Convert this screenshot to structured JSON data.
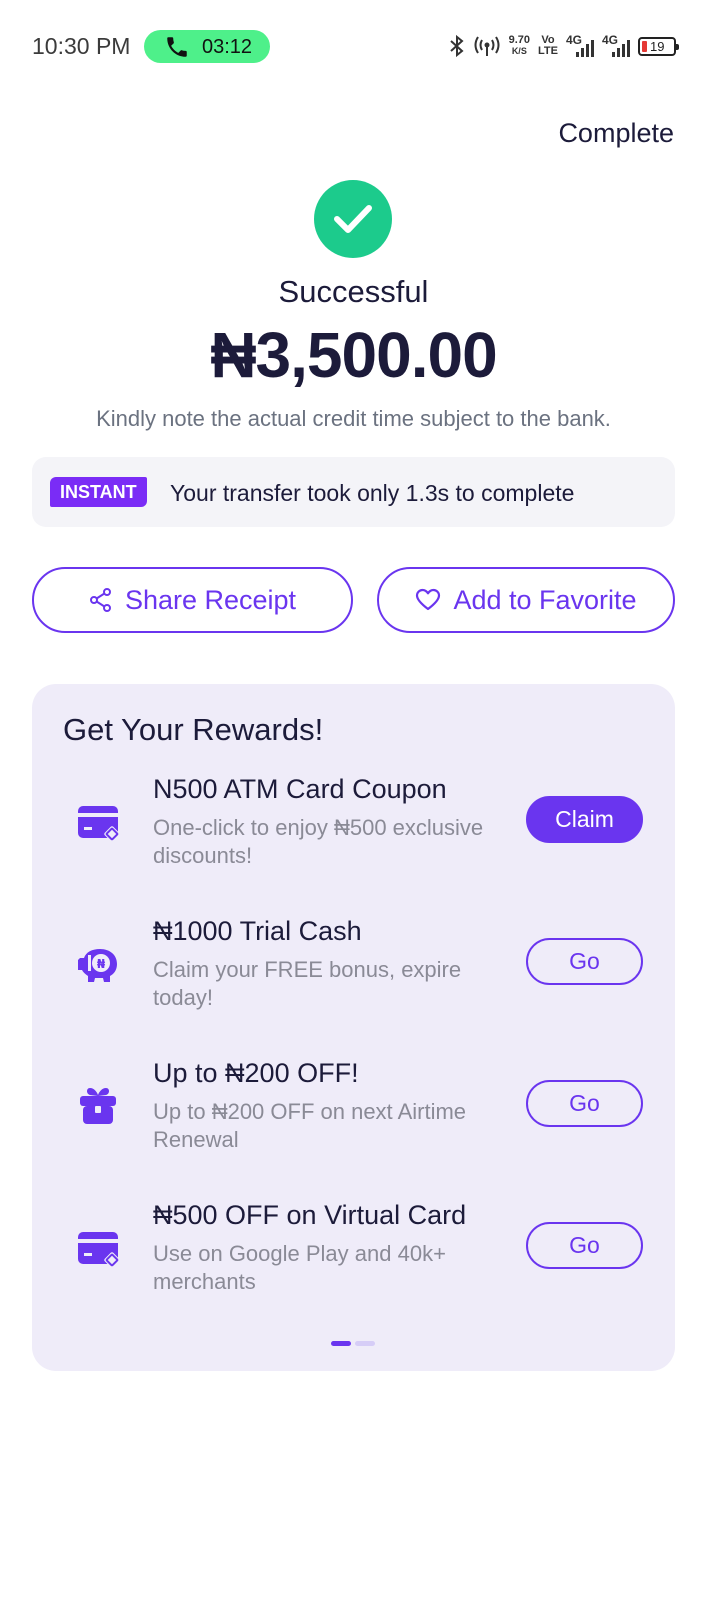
{
  "status_bar": {
    "time": "10:30 PM",
    "call_duration": "03:12",
    "net_speed_value": "9.70",
    "net_speed_unit": "K/S",
    "volte_top": "Vo",
    "volte_bottom": "LTE",
    "sim1_label": "4G",
    "sim2_label": "4G",
    "battery_level": "19"
  },
  "header": {
    "complete_label": "Complete"
  },
  "result": {
    "status": "Successful",
    "amount": "₦3,500.00",
    "note": "Kindly note the actual credit time subject to the bank."
  },
  "instant": {
    "badge": "INSTANT",
    "text": "Your transfer took only 1.3s to complete"
  },
  "actions": {
    "share_label": "Share Receipt",
    "favorite_label": "Add to Favorite"
  },
  "rewards": {
    "title": "Get Your Rewards!",
    "items": [
      {
        "icon": "card-coupon-icon",
        "title": "N500 ATM Card Coupon",
        "desc": "One-click to enjoy ₦500 exclusive discounts!",
        "button": "Claim",
        "style": "filled"
      },
      {
        "icon": "piggy-cash-icon",
        "title": "₦1000 Trial Cash",
        "desc": "Claim your FREE bonus, expire today!",
        "button": "Go",
        "style": "outline"
      },
      {
        "icon": "gift-icon",
        "title": "Up to ₦200 OFF!",
        "desc": "Up to ₦200 OFF on next Airtime Renewal",
        "button": "Go",
        "style": "outline"
      },
      {
        "icon": "virtual-card-icon",
        "title": "₦500 OFF on Virtual Card",
        "desc": "Use on Google Play and 40k+ merchants",
        "button": "Go",
        "style": "outline"
      }
    ],
    "page_indicator": {
      "current": 1,
      "total": 2
    }
  },
  "colors": {
    "accent": "#6a35ef",
    "success": "#1ccb8c",
    "call_pill": "#4ef08a",
    "card_bg": "#efecf9"
  }
}
